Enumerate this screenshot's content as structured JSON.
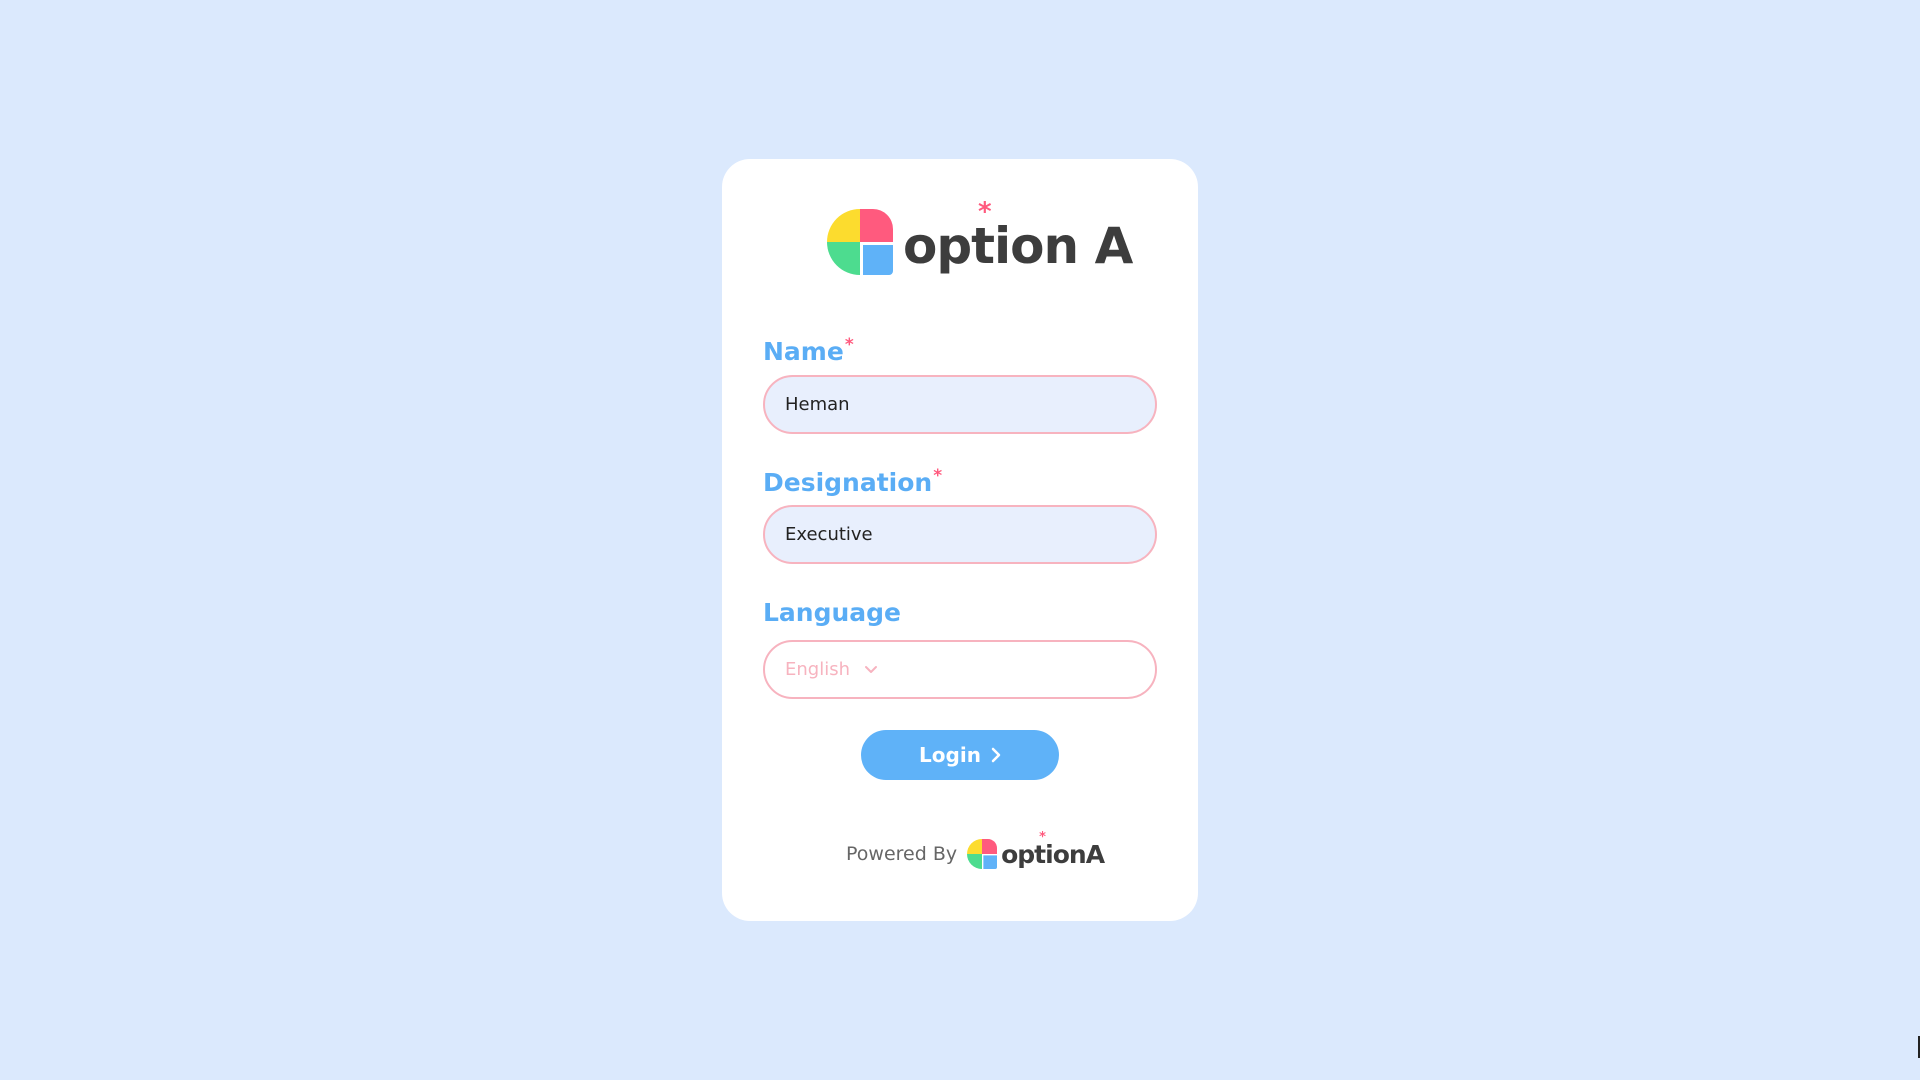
{
  "brand": {
    "name": "option",
    "suffix": "A",
    "star": "*"
  },
  "form": {
    "name_label": "Name",
    "name_required": "*",
    "name_value": "Heman",
    "designation_label": "Designation",
    "designation_required": "*",
    "designation_value": "Executive",
    "language_label": "Language",
    "language_value": "English",
    "login_label": "Login"
  },
  "footer": {
    "powered_by": "Powered By"
  },
  "colors": {
    "background": "#dbe9fd",
    "card": "#ffffff",
    "label": "#5aadf5",
    "required": "#ff5a7e",
    "input_border": "#f7b3bf",
    "input_fill": "#e8effd",
    "button": "#5fb2f8",
    "logo_yellow": "#fcdc2e",
    "logo_pink": "#ff5a7e",
    "logo_green": "#4ddc8f",
    "logo_blue": "#5fb2f8"
  },
  "icons": {
    "language_dropdown": "chevron-down-icon",
    "login": "chevron-right-icon"
  }
}
